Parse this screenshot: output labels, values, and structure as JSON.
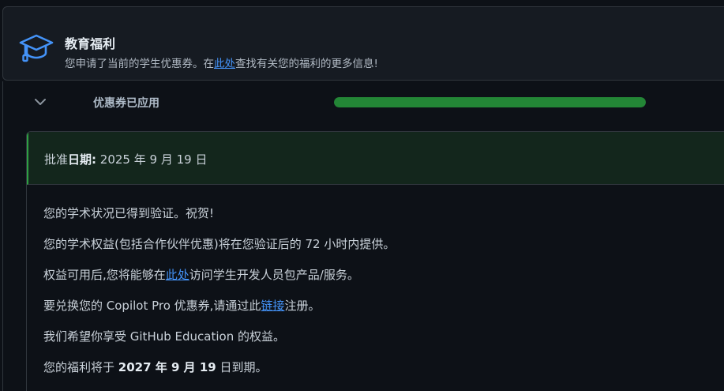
{
  "header": {
    "title": "教育福利",
    "sub_prefix": "您申请了当前的学生优惠券。在",
    "sub_link": "此处",
    "sub_suffix": "查找有关您的福利的更多信息!",
    "icon": "graduation-cap-icon"
  },
  "status": {
    "label": "优惠券已应用",
    "progress": 1.0,
    "progress_color": "#238636"
  },
  "approval": {
    "prefix": "批准",
    "bold": "日期:",
    "date": "2025 年 9 月 19 日"
  },
  "lines": {
    "l1": "您的学术状况已得到验证。祝贺!",
    "l2": "您的学术权益(包括合作伙伴优惠)将在您验证后的 72 小时内提供。",
    "l3_prefix": "权益可用后,您将能够在",
    "l3_link": "此处",
    "l3_suffix": "访问学生开发人员包产品/服务。",
    "l4_prefix": "要兑换您的 Copilot Pro 优惠券,请通过此",
    "l4_link": "链接",
    "l4_suffix": "注册。",
    "l5": "我们希望你享受 GitHub Education 的权益。",
    "l6_prefix": "您的福利将于 ",
    "l6_bold": "2027 年 9 月 19",
    "l6_suffix": " 日到期。"
  },
  "colors": {
    "link": "#4493f8",
    "accent_green": "#2ea043"
  }
}
